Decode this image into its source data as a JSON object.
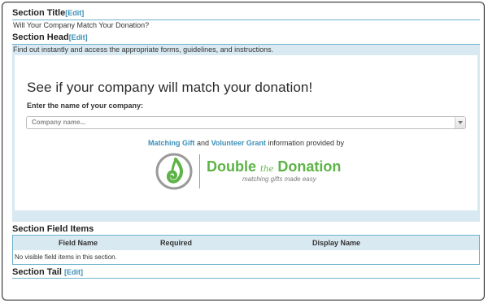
{
  "section_title": {
    "heading": "Section Title",
    "edit_label": "[Edit]",
    "value": "Will Your Company Match Your Donation?"
  },
  "section_head": {
    "heading": "Section Head",
    "edit_label": "[Edit]",
    "value": "Find out instantly and access the appropriate forms, guidelines, and instructions."
  },
  "widget": {
    "title": "See if your company will match your donation!",
    "enter_label": "Enter the name of your company:",
    "company_placeholder": "Company name...",
    "matching_gift_link": "Matching Gift",
    "and_text": "and",
    "volunteer_grant_link": "Volunteer Grant",
    "provided_text": "information provided by",
    "logo": {
      "name_part1": "Double",
      "name_the": "the",
      "name_part2": "Donation",
      "tagline": "matching gifts made easy",
      "colors": {
        "green": "#5db345",
        "gray": "#7a7a7a"
      }
    }
  },
  "section_field_items": {
    "heading": "Section Field Items",
    "columns": [
      "Field Name",
      "Required",
      "Display Name"
    ],
    "empty_message": "No visible field items in this section."
  },
  "section_tail": {
    "heading": "Section Tail",
    "edit_label": "[Edit]"
  },
  "colors": {
    "accent_link": "#3a8fb7",
    "band_bg": "#d9e9f1",
    "rule": "#6db3cf"
  }
}
